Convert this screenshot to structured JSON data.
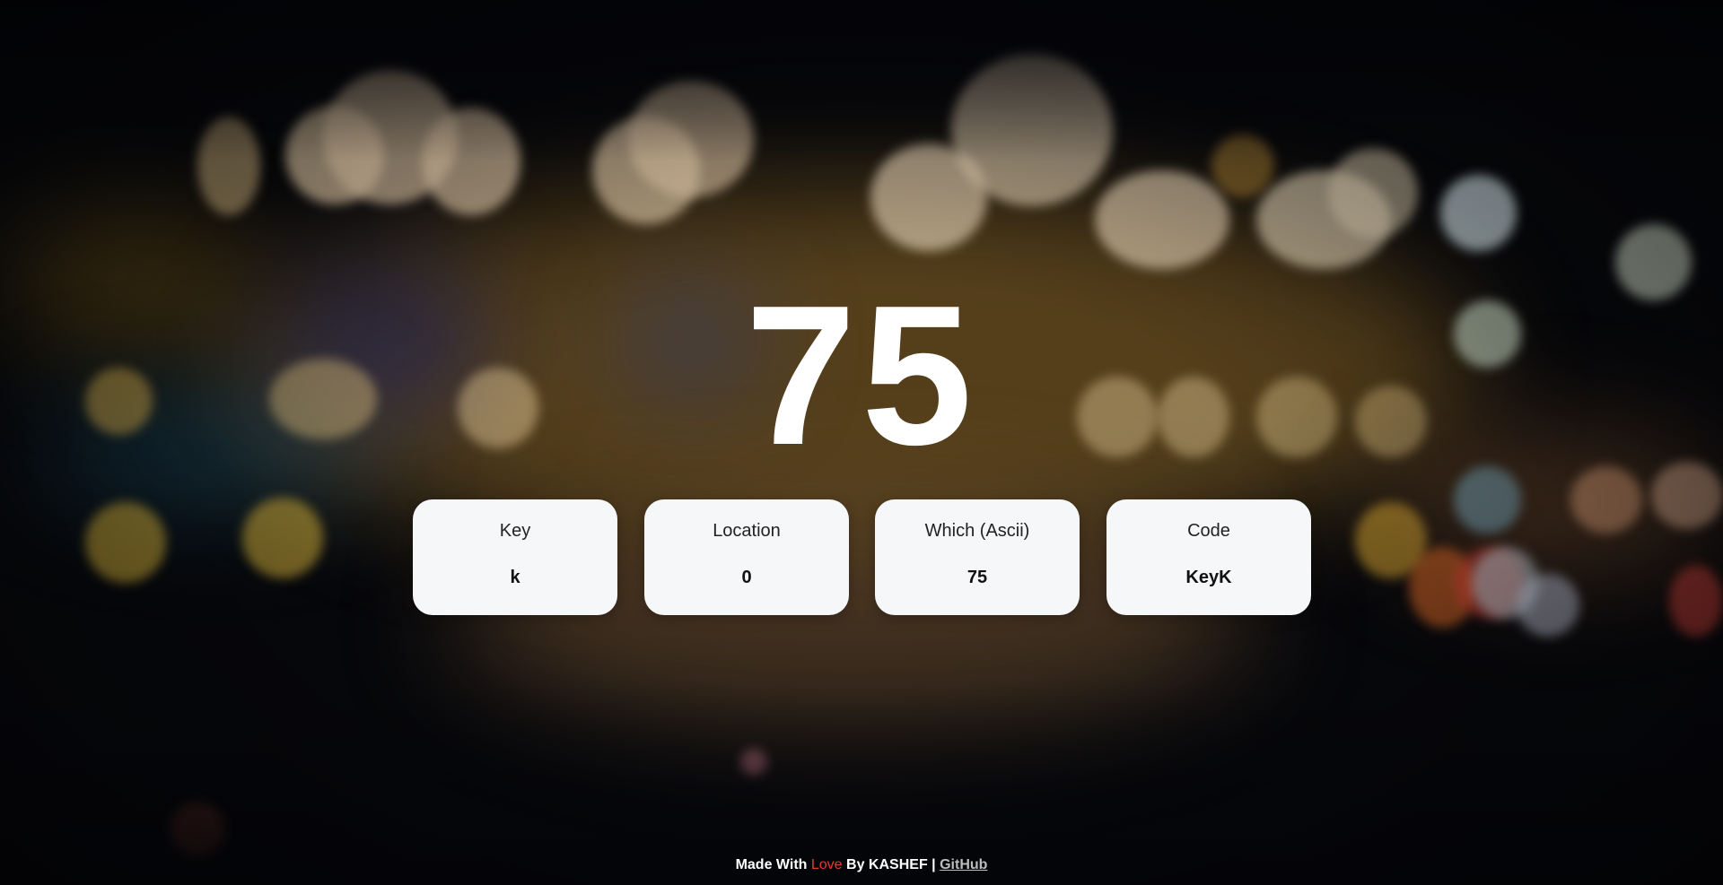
{
  "display": {
    "code": "75"
  },
  "cards": [
    {
      "label": "Key",
      "value": "k"
    },
    {
      "label": "Location",
      "value": "0"
    },
    {
      "label": "Which (Ascii)",
      "value": "75"
    },
    {
      "label": "Code",
      "value": "KeyK"
    }
  ],
  "footer": {
    "made_with": "Made With",
    "love": "Love",
    "by": "By KASHEF |",
    "github": "GitHub"
  },
  "colors": {
    "card_background": "#f6f7f9",
    "love_accent": "#e53935",
    "link": "#bdbdbd",
    "text_on_background": "#ffffff"
  }
}
